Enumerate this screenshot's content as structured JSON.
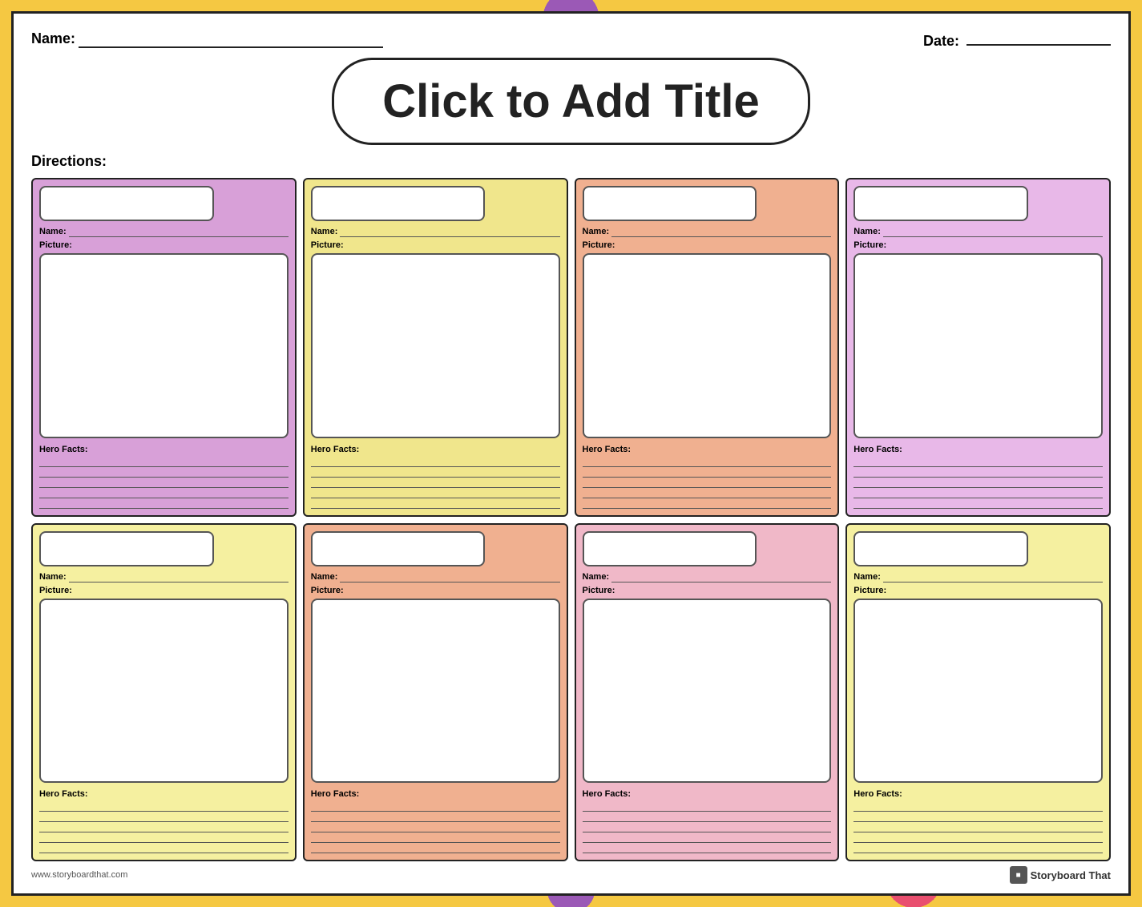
{
  "page": {
    "border_color": "#f5c842",
    "header": {
      "name_label": "Name:",
      "date_label": "Date:"
    },
    "title": {
      "text": "Click to Add Title"
    },
    "directions": {
      "label": "Directions:"
    },
    "footer": {
      "website": "www.storyboardthat.com",
      "brand": "Storyboard That"
    }
  },
  "cards": [
    {
      "id": 1,
      "bg_class": "card-purple",
      "name_label": "Name:",
      "picture_label": "Picture:",
      "hero_label": "Hero Facts:",
      "lines": 5
    },
    {
      "id": 2,
      "bg_class": "card-yellow",
      "name_label": "Name:",
      "picture_label": "Picture:",
      "hero_label": "Hero Facts:",
      "lines": 5
    },
    {
      "id": 3,
      "bg_class": "card-peach",
      "name_label": "Name:",
      "picture_label": "Picture:",
      "hero_label": "Hero Facts:",
      "lines": 5
    },
    {
      "id": 4,
      "bg_class": "card-light-purple",
      "name_label": "Name:",
      "picture_label": "Picture:",
      "hero_label": "Hero Facts:",
      "lines": 5
    },
    {
      "id": 5,
      "bg_class": "card-light-yellow",
      "name_label": "Name:",
      "picture_label": "Picture:",
      "hero_label": "Hero Facts:",
      "lines": 5
    },
    {
      "id": 6,
      "bg_class": "card-peach",
      "name_label": "Name:",
      "picture_label": "Picture:",
      "hero_label": "Hero Facts:",
      "lines": 5
    },
    {
      "id": 7,
      "bg_class": "card-pink",
      "name_label": "Name:",
      "picture_label": "Picture:",
      "hero_label": "Hero Facts:",
      "lines": 5
    },
    {
      "id": 8,
      "bg_class": "card-light-yellow",
      "name_label": "Name:",
      "picture_label": "Picture:",
      "hero_label": "Hero Facts:",
      "lines": 5
    }
  ]
}
